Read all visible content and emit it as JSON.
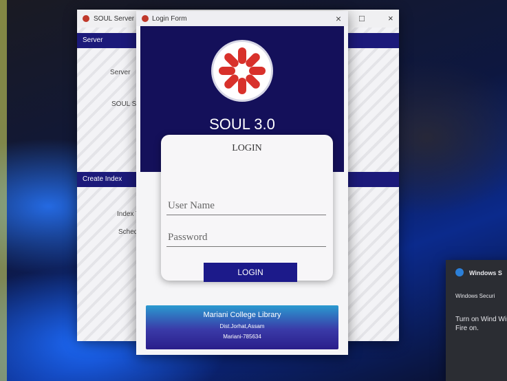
{
  "server_window": {
    "title": "SOUL Server",
    "band1": "Server",
    "label_server": "Server",
    "label_soul": "SOUL S",
    "band2": "Create Index",
    "label_index": "Index T",
    "label_sched": "Schedu",
    "controls": {
      "max": "□",
      "close": "×"
    }
  },
  "login_window": {
    "title": "Login Form",
    "close": "×",
    "app_title": "SOUL 3.0",
    "card_title": "LOGIN",
    "username_placeholder": "User Name",
    "password_placeholder": "Password",
    "login_button": "LOGIN",
    "footer": {
      "line1": "Mariani College Library",
      "line2": "Dist.Jorhat,Assam",
      "line3": "Mariani-785634"
    }
  },
  "toast": {
    "title": "Windows S",
    "subtitle": "Windows Securi",
    "body": "Turn on Wind Windows Fire on."
  },
  "colors": {
    "navy": "#14105a",
    "band": "#1c1a7a",
    "logo_red": "#d8312b"
  },
  "icons": [
    "soul-logo-icon",
    "window-app-icon",
    "close-icon",
    "maximize-icon",
    "shield-icon"
  ]
}
